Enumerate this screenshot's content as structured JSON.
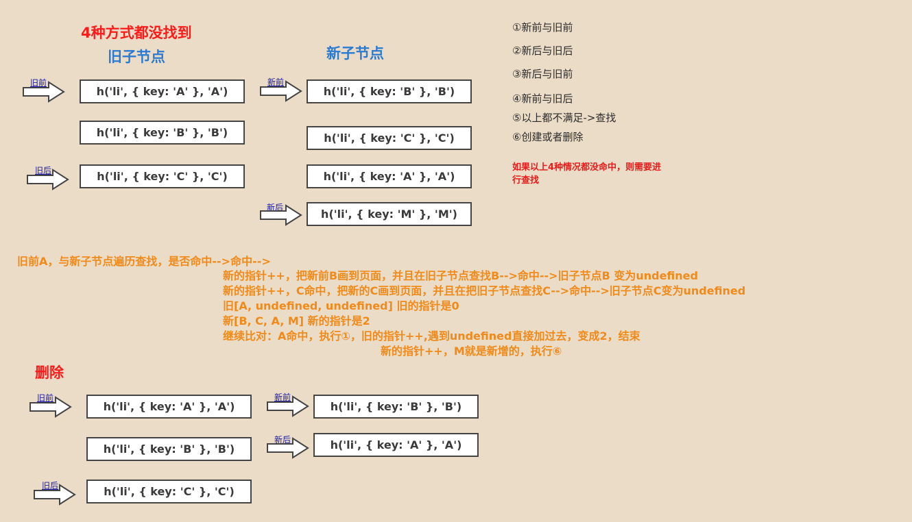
{
  "titles": {
    "main": "4种方式都没找到",
    "old_nodes": "旧子节点",
    "new_nodes": "新子节点",
    "delete": "删除"
  },
  "pointers": {
    "old_start": "旧前",
    "old_end": "旧后",
    "new_start": "新前",
    "new_end": "新后"
  },
  "section1": {
    "old": [
      "h('li', { key: 'A' }, 'A')",
      "h('li', { key: 'B' }, 'B')",
      "h('li', { key: 'C' }, 'C')"
    ],
    "new": [
      "h('li', { key: 'B' }, 'B')",
      "h('li', { key: 'C' }, 'C')",
      "h('li', { key: 'A' }, 'A')",
      "h('li', { key: 'M' }, 'M')"
    ]
  },
  "steps": [
    "①新前与旧前",
    "②新后与旧后",
    "③新后与旧前",
    "④新前与旧后",
    "⑤以上都不满足->查找",
    "⑥创建或者删除"
  ],
  "note": "如果以上4种情况都没命中，则需要进行查找",
  "explanation": [
    "旧前A，与新子节点遍历查找，是否命中-->命中-->",
    "新的指针++，把新前B画到页面，并且在旧子节点查找B-->命中-->旧子节点B 变为undefined",
    "新的指针++，C命中，把新的C画到页面，并且在把旧子节点查找C-->命中-->旧子节点C变为undefined",
    "旧[A, undefined, undefined] 旧的指针是0",
    "新[B, C, A, M] 新的指针是2",
    "继续比对：A命中，执行①，旧的指针++,遇到undefined直接加过去，变成2，结束",
    "新的指针++，M就是新增的，执行⑥"
  ],
  "section2": {
    "old": [
      "h('li', { key: 'A' }, 'A')",
      "h('li', { key: 'B' }, 'B')",
      "h('li', { key: 'C' }, 'C')"
    ],
    "new": [
      "h('li', { key: 'B' }, 'B')",
      "h('li', { key: 'A' }, 'A')"
    ]
  },
  "colors": {
    "background": "#eadcc6",
    "title_red": "#ff1a1a",
    "title_blue": "#2a7ad2",
    "explanation_orange": "#f08a1a",
    "pointer_label": "#1a1aa6"
  }
}
